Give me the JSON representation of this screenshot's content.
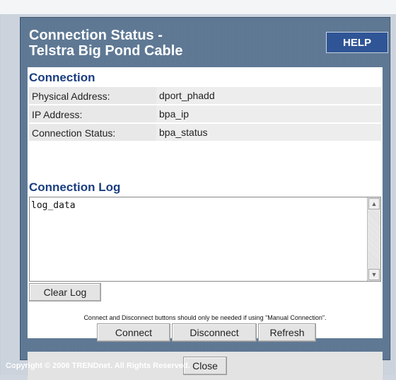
{
  "header": {
    "title_line1": "Connection Status -",
    "title_line2": "Telstra Big Pond Cable",
    "help_label": "HELP"
  },
  "connection": {
    "section_title": "Connection",
    "rows": [
      {
        "label": "Physical Address:",
        "value": "dport_phadd"
      },
      {
        "label": "IP Address:",
        "value": "bpa_ip"
      },
      {
        "label": "Connection Status:",
        "value": "bpa_status"
      }
    ]
  },
  "log": {
    "section_title": "Connection Log",
    "content": "log_data",
    "clear_label": "Clear Log"
  },
  "note": "Connect and Disconnect buttons should only be needed if using \"Manual Connection\".",
  "actions": {
    "connect_label": "Connect",
    "disconnect_label": "Disconnect",
    "refresh_label": "Refresh",
    "close_label": "Close"
  },
  "footer": "Copyright © 2006 TRENDnet. All Rights Reserved.",
  "icons": {
    "scroll_up": "scroll-up-arrow-icon",
    "scroll_down": "scroll-down-arrow-icon"
  },
  "colors": {
    "panel": "#5d7590",
    "section_title": "#1b3e80",
    "help_button": "#2f5596"
  }
}
